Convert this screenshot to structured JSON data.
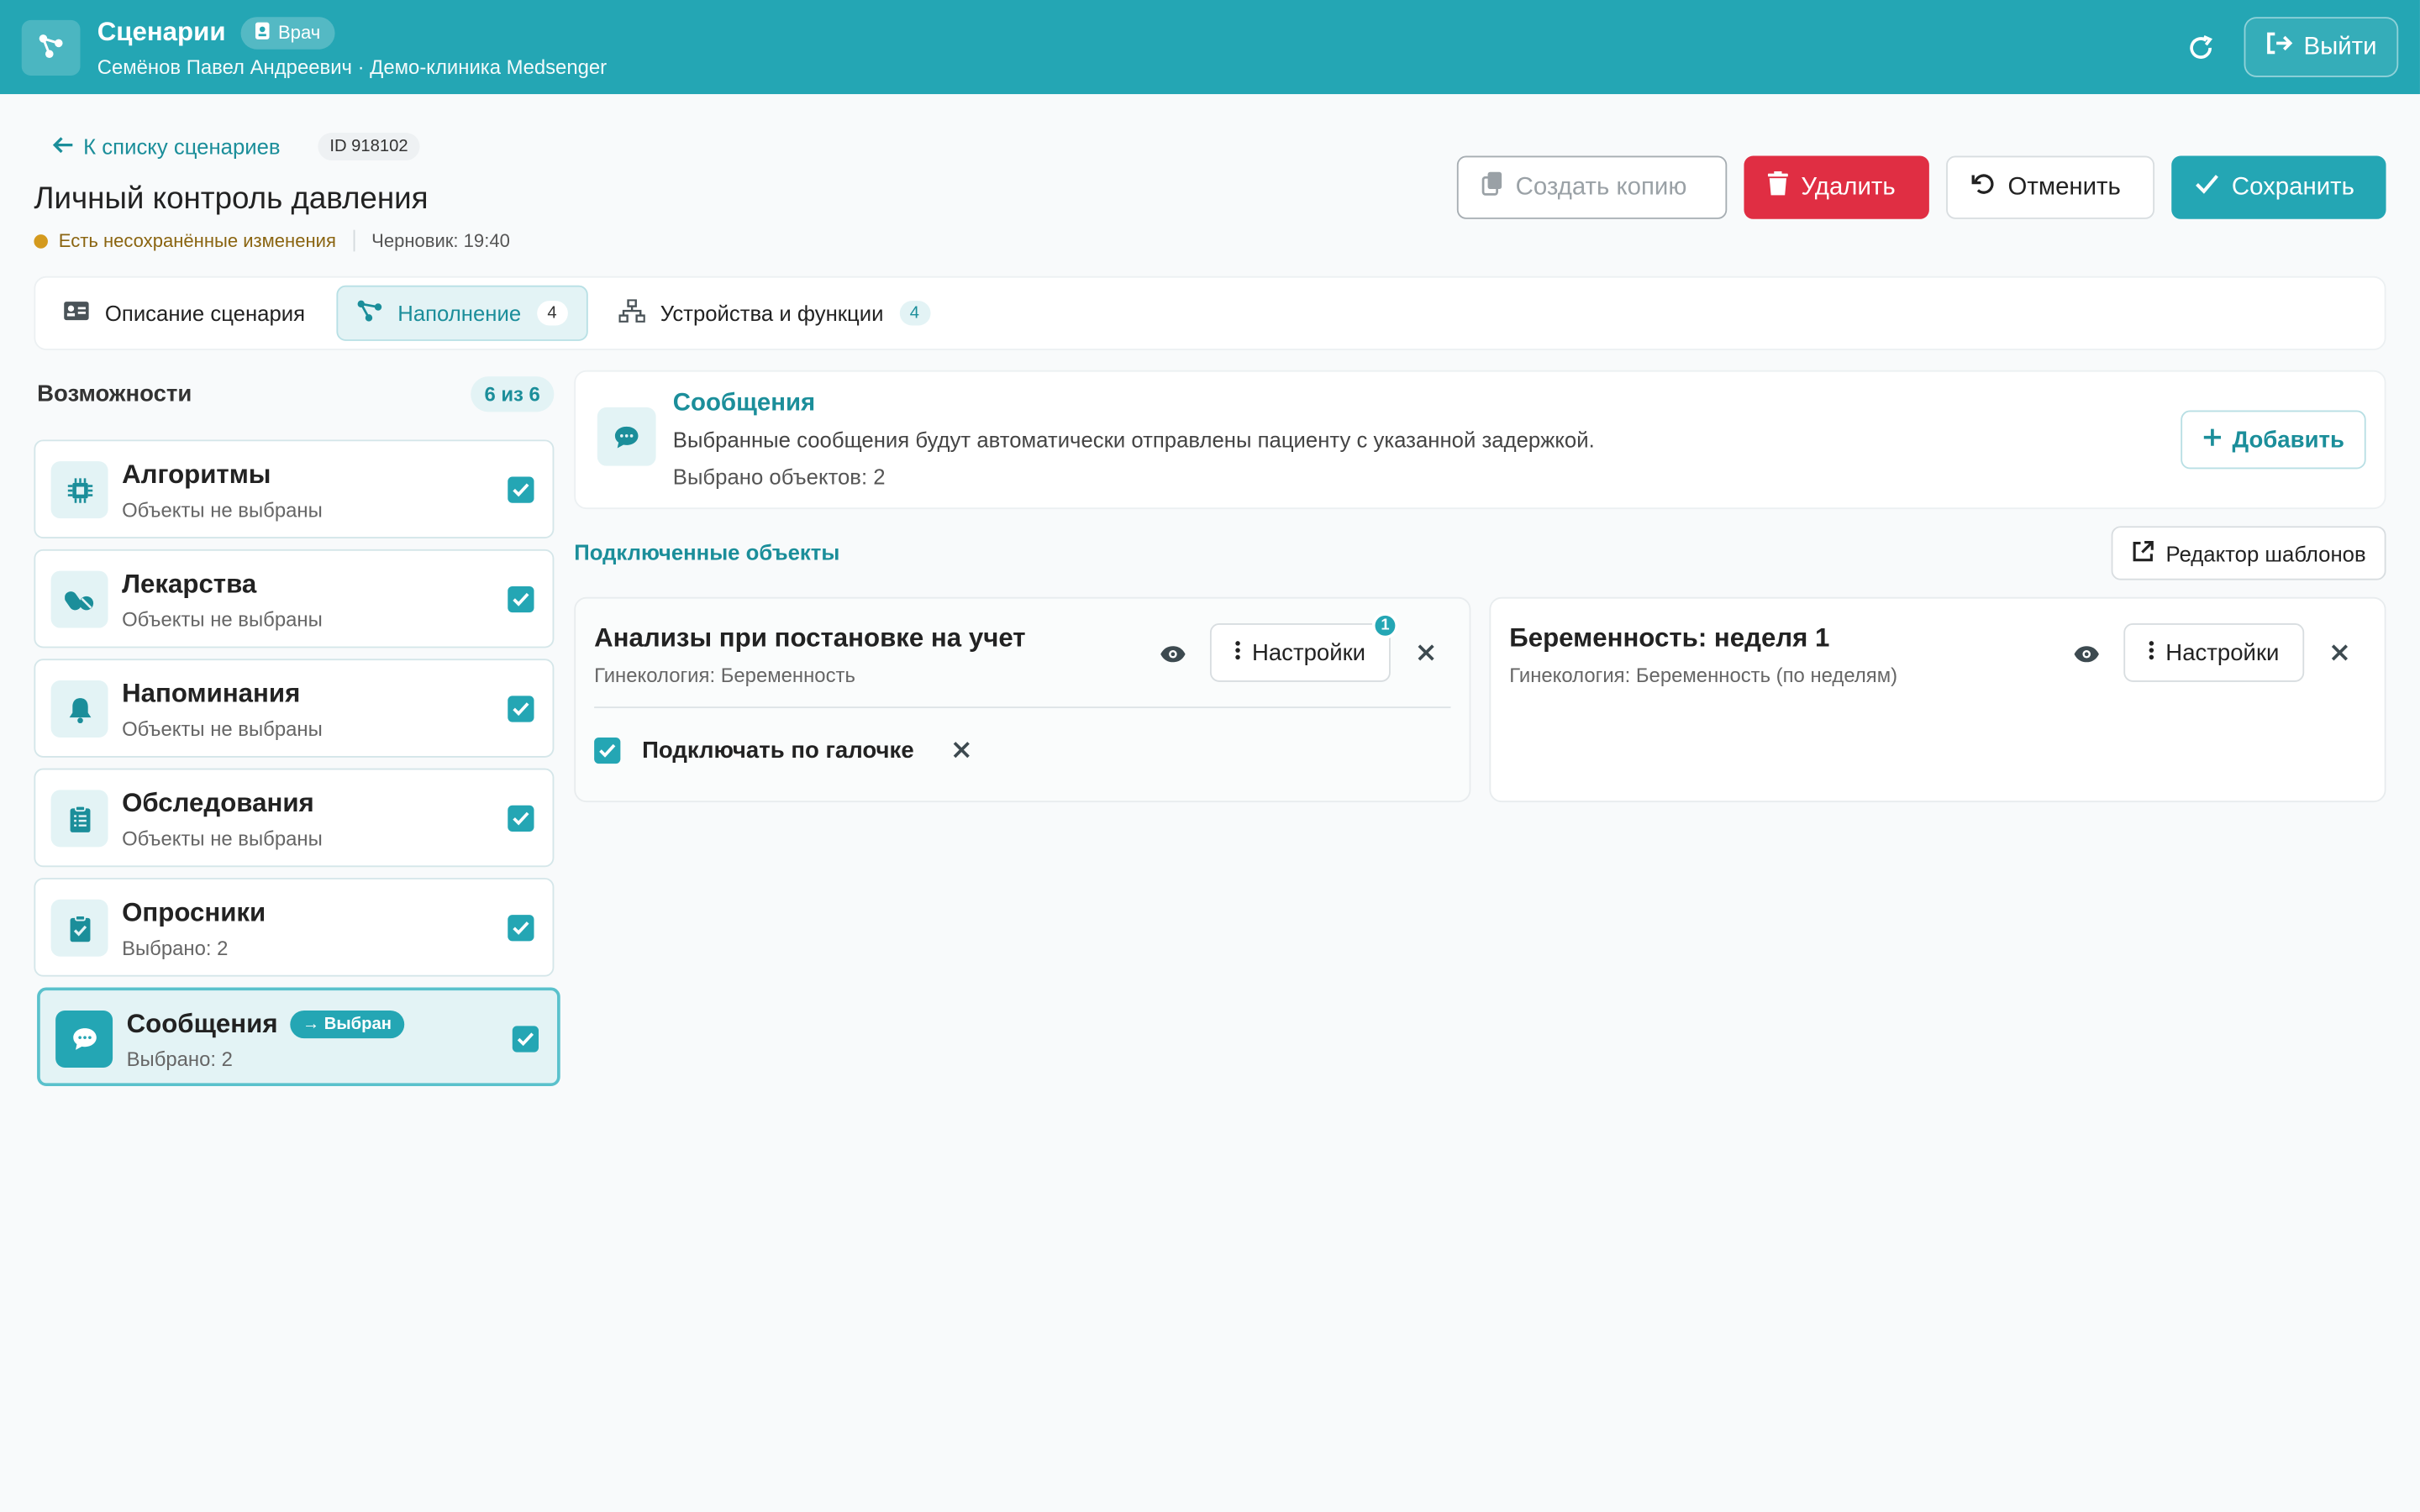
{
  "header": {
    "title": "Сценарии",
    "role_badge": "Врач",
    "subtitle": "Семёнов Павел Андреевич · Демо-клиника Medsenger",
    "logout_label": "Выйти"
  },
  "toolbar": {
    "back_label": "К списку сценариев",
    "id_label": "ID 918102",
    "page_title": "Личный контроль давления",
    "unsaved_text": "Есть несохранённые изменения",
    "draft_text": "Черновик: 19:40",
    "copy_label": "Создать копию",
    "delete_label": "Удалить",
    "cancel_label": "Отменить",
    "save_label": "Сохранить"
  },
  "tabs": [
    {
      "label": "Описание сценария"
    },
    {
      "label": "Наполнение",
      "count": "4"
    },
    {
      "label": "Устройства и функции",
      "count": "4"
    }
  ],
  "sidebar": {
    "title": "Возможности",
    "count": "6 из 6",
    "items": [
      {
        "name": "Алгоритмы",
        "status": "Объекты не выбраны",
        "icon": "chip-icon"
      },
      {
        "name": "Лекарства",
        "status": "Объекты не выбраны",
        "icon": "pills-icon"
      },
      {
        "name": "Напоминания",
        "status": "Объекты не выбраны",
        "icon": "bell-icon"
      },
      {
        "name": "Обследования",
        "status": "Объекты не выбраны",
        "icon": "clipboard-list-icon"
      },
      {
        "name": "Опросники",
        "status": "Выбрано: 2",
        "icon": "clipboard-check-icon"
      },
      {
        "name": "Сообщения",
        "status": "Выбрано: 2",
        "icon": "chat-icon",
        "badge": "Выбран"
      }
    ]
  },
  "info": {
    "title": "Сообщения",
    "description": "Выбранные сообщения будут автоматически отправлены пациенту с указанной задержкой.",
    "count": "Выбрано объектов: 2",
    "add_label": "Добавить"
  },
  "connected": {
    "title": "Подключенные объекты",
    "templates_label": "Редактор шаблонов",
    "objects": [
      {
        "title": "Анализы при постановке на учет",
        "subtitle": "Гинекология: Беременность",
        "settings_label": "Настройки",
        "settings_count": "1",
        "option_label": "Подключать по галочке"
      },
      {
        "title": "Беременность: неделя 1",
        "subtitle": "Гинекология: Беременность (по неделям)",
        "settings_label": "Настройки"
      }
    ]
  },
  "colors": {
    "accent": "#24a6b4",
    "danger": "#e02e43",
    "warning": "#d49a1e"
  }
}
